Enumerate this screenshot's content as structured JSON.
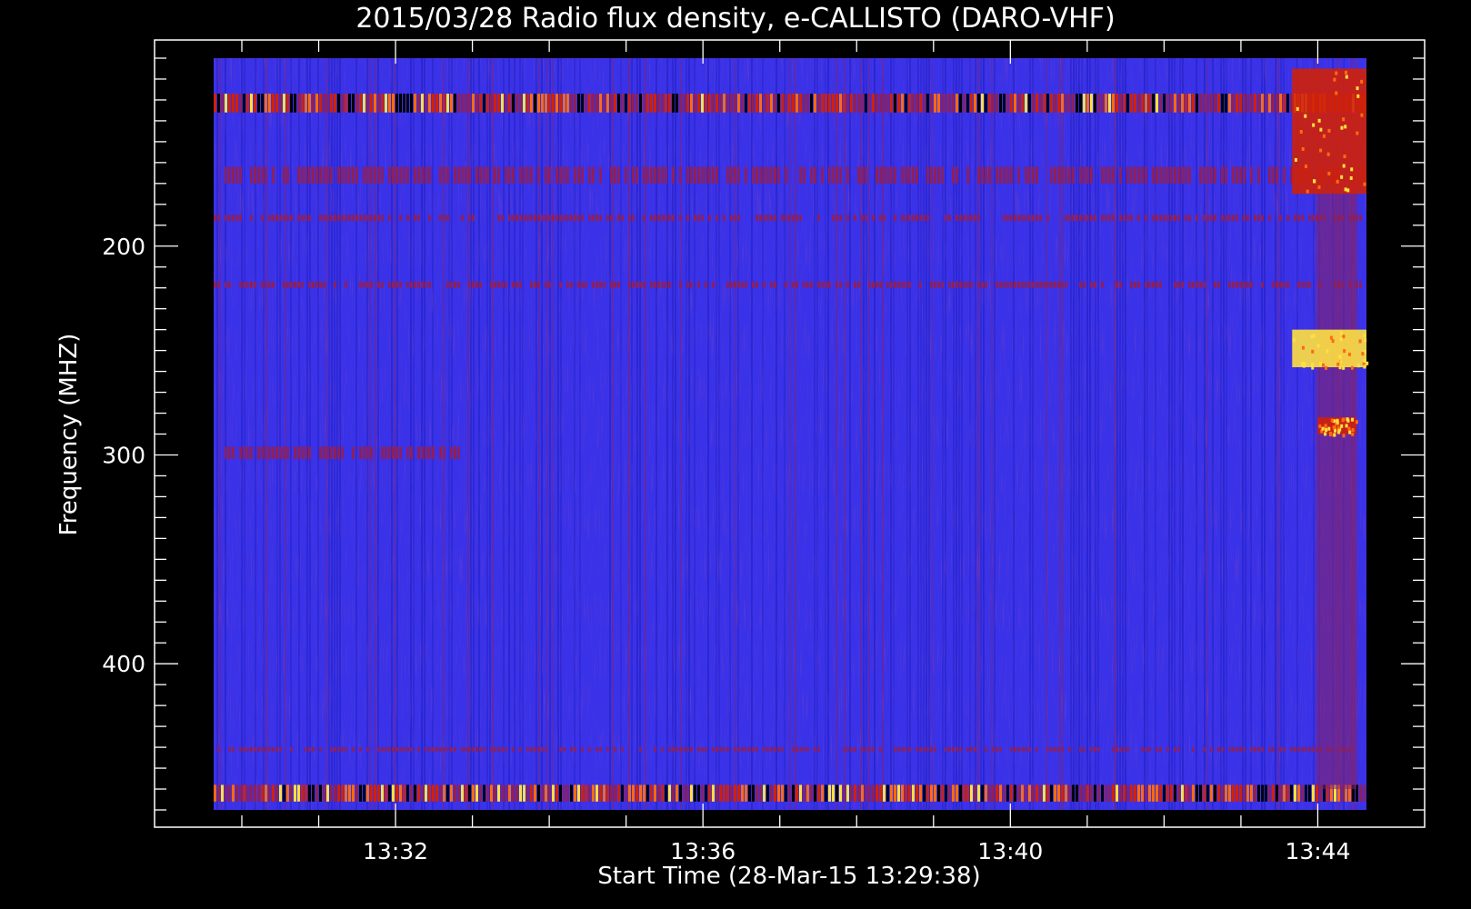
{
  "chart_data": {
    "type": "heatmap",
    "title": "2015/03/28  Radio flux density, e-CALLISTO (DARO-VHF)",
    "xlabel": "Start Time (28-Mar-15 13:29:38)",
    "ylabel": "Frequency (MHZ)",
    "xlim": [
      "13:29:38",
      "13:44:38"
    ],
    "ylim": [
      470,
      110
    ],
    "x_ticks": [
      "13:32",
      "13:36",
      "13:40",
      "13:44"
    ],
    "y_ticks": [
      200,
      300,
      400
    ],
    "colormap": [
      "#000000",
      "#1a1ab8",
      "#3a32e8",
      "#8a2060",
      "#d02008",
      "#ff6a10",
      "#ffe040"
    ],
    "background_level": "blue",
    "features": [
      {
        "kind": "rfi-band",
        "freq_mhz": [
          127,
          136
        ],
        "time": [
          "13:29:38",
          "13:44:38"
        ],
        "level": "high"
      },
      {
        "kind": "rfi-band",
        "freq_mhz": [
          162,
          170
        ],
        "time": [
          "13:29:38",
          "13:44:38"
        ],
        "level": "medium"
      },
      {
        "kind": "rfi-band",
        "freq_mhz": [
          185,
          188
        ],
        "time": [
          "13:29:38",
          "13:44:38"
        ],
        "level": "medium"
      },
      {
        "kind": "rfi-band",
        "freq_mhz": [
          217,
          220
        ],
        "time": [
          "13:29:38",
          "13:44:38"
        ],
        "level": "medium"
      },
      {
        "kind": "rfi-band",
        "freq_mhz": [
          296,
          302
        ],
        "time": [
          "13:29:38",
          "13:32:50"
        ],
        "level": "medium"
      },
      {
        "kind": "rfi-band",
        "freq_mhz": [
          440,
          442
        ],
        "time": [
          "13:29:38",
          "13:44:38"
        ],
        "level": "medium"
      },
      {
        "kind": "rfi-band",
        "freq_mhz": [
          458,
          466
        ],
        "time": [
          "13:29:38",
          "13:44:38"
        ],
        "level": "high"
      },
      {
        "kind": "burst",
        "freq_mhz": [
          115,
          175
        ],
        "time": [
          "13:43:40",
          "13:44:38"
        ],
        "level": "high"
      },
      {
        "kind": "burst",
        "freq_mhz": [
          175,
          460
        ],
        "time": [
          "13:44:00",
          "13:44:30"
        ],
        "level": "medium"
      },
      {
        "kind": "burst",
        "freq_mhz": [
          240,
          258
        ],
        "time": [
          "13:43:40",
          "13:44:38"
        ],
        "level": "peak"
      },
      {
        "kind": "burst",
        "freq_mhz": [
          282,
          290
        ],
        "time": [
          "13:44:00",
          "13:44:30"
        ],
        "level": "high"
      }
    ]
  }
}
